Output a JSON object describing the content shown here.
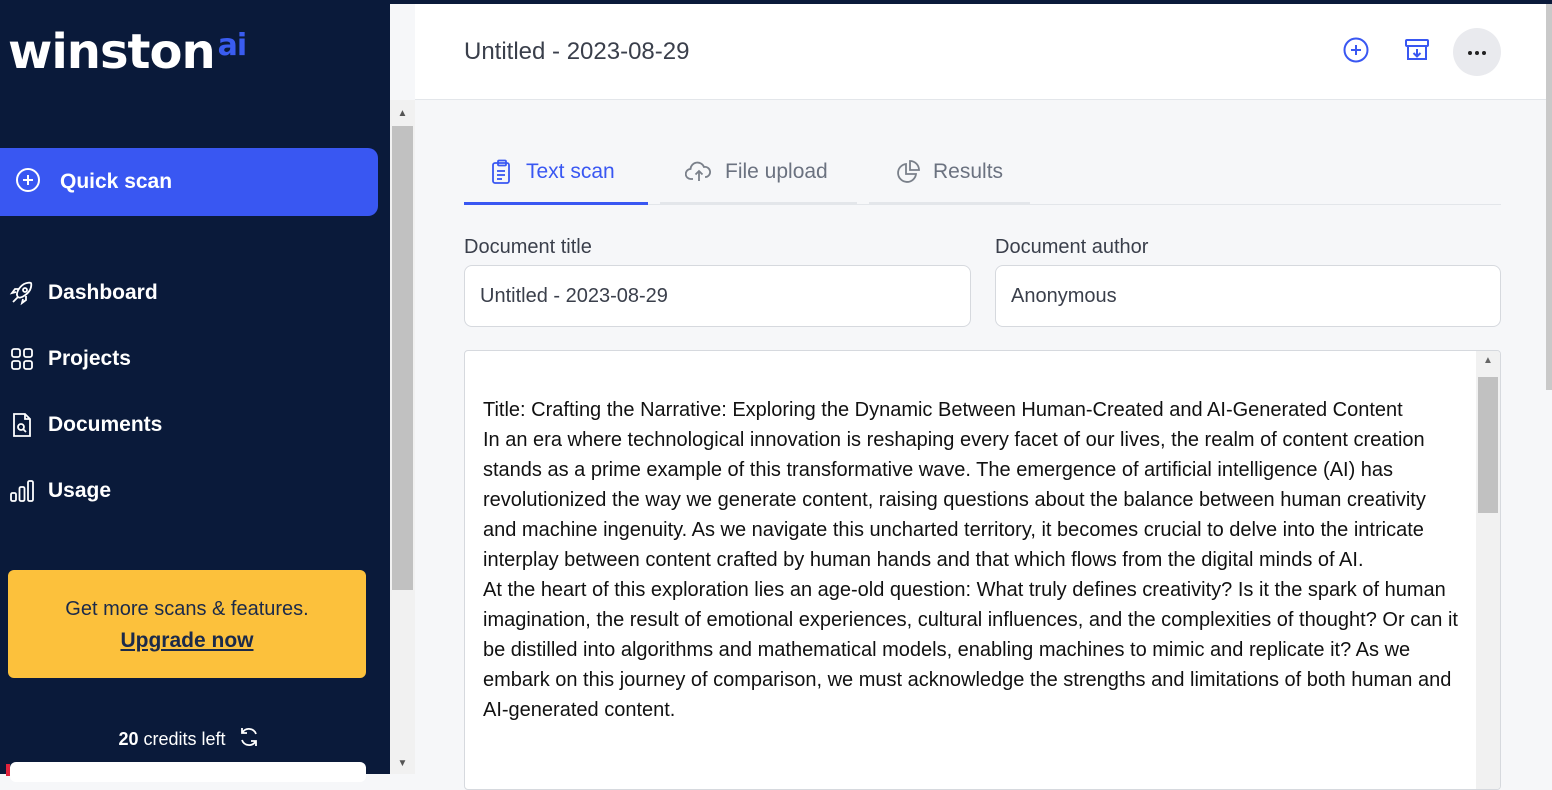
{
  "sidebar": {
    "logo_text": "winston",
    "logo_suffix": "ai",
    "quick_scan_label": "Quick scan",
    "nav": [
      {
        "label": "Dashboard",
        "icon": "rocket-icon"
      },
      {
        "label": "Projects",
        "icon": "grid-icon"
      },
      {
        "label": "Documents",
        "icon": "document-search-icon"
      },
      {
        "label": "Usage",
        "icon": "bar-chart-icon"
      }
    ],
    "upgrade_text": "Get more scans & features.",
    "upgrade_link": "Upgrade now",
    "credits_count": "20",
    "credits_label": "credits left"
  },
  "header": {
    "title": "Untitled - 2023-08-29"
  },
  "tabs": [
    {
      "label": "Text scan",
      "icon": "clipboard-icon",
      "active": true
    },
    {
      "label": "File upload",
      "icon": "cloud-upload-icon",
      "active": false
    },
    {
      "label": "Results",
      "icon": "pie-chart-icon",
      "active": false
    }
  ],
  "form": {
    "title_label": "Document title",
    "title_value": "Untitled - 2023-08-29",
    "author_label": "Document author",
    "author_value": "Anonymous"
  },
  "text": {
    "paragraphs": [
      "Title: Crafting the Narrative: Exploring the Dynamic Between Human-Created and AI-Generated Content",
      "In an era where technological innovation is reshaping every facet of our lives, the realm of content creation stands as a prime example of this transformative wave. The emergence of artificial intelligence (AI) has revolutionized the way we generate content, raising questions about the balance between human creativity and machine ingenuity. As we navigate this uncharted territory, it becomes crucial to delve into the intricate interplay between content crafted by human hands and that which flows from the digital minds of AI.",
      "At the heart of this exploration lies an age-old question: What truly defines creativity? Is it the spark of human imagination, the result of emotional experiences, cultural influences, and the complexities of thought? Or can it be distilled into algorithms and mathematical models, enabling machines to mimic and replicate it? As we embark on this journey of comparison, we must acknowledge the strengths and limitations of both human and AI-generated content."
    ]
  },
  "colors": {
    "sidebar_bg": "#0a1a3a",
    "accent": "#3957f2",
    "upgrade_bg": "#fcc13c"
  }
}
